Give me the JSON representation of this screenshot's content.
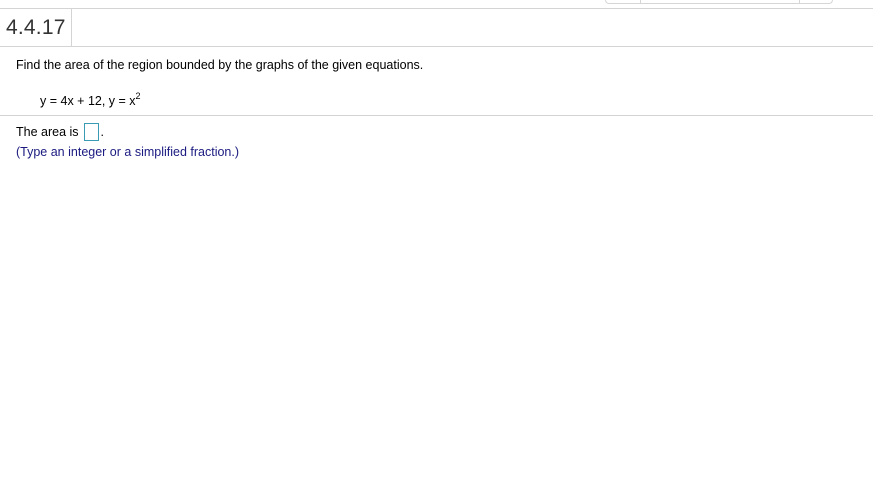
{
  "question": {
    "number": "4.4.17",
    "prompt": "Find the area of the region bounded by the graphs of the given equations.",
    "equation_main": "y = 4x + 12, y = x",
    "equation_exponent": "2"
  },
  "answer": {
    "label": "The area is",
    "value": "",
    "suffix": ".",
    "hint": "(Type an integer or a simplified fraction.)"
  },
  "colors": {
    "input_border": "#3a9bb5",
    "hint_text": "#1a1a80",
    "divider": "#d4d4d4"
  }
}
